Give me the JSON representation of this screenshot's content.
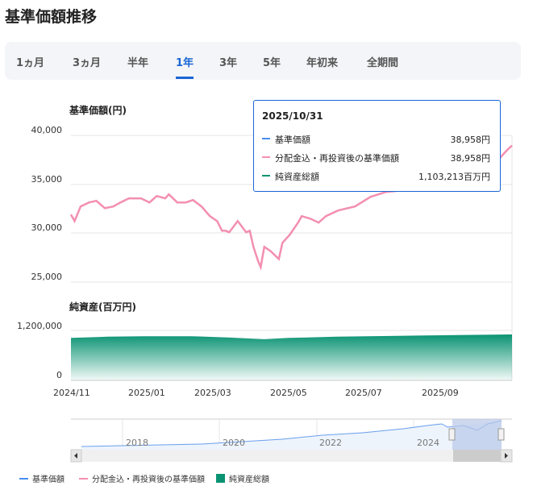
{
  "title": "基準価額推移",
  "tabs": [
    "1ヵ月",
    "3ヵ月",
    "半年",
    "1年",
    "3年",
    "5年",
    "年初来",
    "全期間"
  ],
  "active_tab": "1年",
  "colors": {
    "nav": "#4a8ef0",
    "reinvested": "#f48fb1",
    "assets": "#0a9373",
    "accent": "#1a66d6"
  },
  "chart_data": [
    {
      "type": "line",
      "title": "基準価額(円)",
      "ylim": [
        25000,
        40000
      ],
      "yticks": [
        "40,000",
        "35,000",
        "30,000",
        "25,000"
      ],
      "x_unit": "days since 2024/10/31",
      "series": [
        {
          "name": "基準価額",
          "points": [
            [
              0,
              31900
            ],
            [
              3,
              31240
            ],
            [
              8,
              32730
            ],
            [
              15,
              33140
            ],
            [
              21,
              33310
            ],
            [
              28,
              32560
            ],
            [
              35,
              32730
            ],
            [
              41,
              33140
            ],
            [
              48,
              33560
            ],
            [
              58,
              33560
            ],
            [
              65,
              33140
            ],
            [
              71,
              33800
            ],
            [
              78,
              33560
            ],
            [
              81,
              33970
            ],
            [
              88,
              33140
            ],
            [
              95,
              33140
            ],
            [
              101,
              33390
            ],
            [
              108,
              32730
            ],
            [
              115,
              31740
            ],
            [
              121,
              31240
            ],
            [
              125,
              30250
            ],
            [
              128,
              30250
            ],
            [
              131,
              30090
            ],
            [
              138,
              31240
            ],
            [
              145,
              30090
            ],
            [
              148,
              30250
            ],
            [
              151,
              28600
            ],
            [
              155,
              27110
            ],
            [
              157,
              26530
            ],
            [
              160,
              28600
            ],
            [
              165,
              28190
            ],
            [
              172,
              27360
            ],
            [
              175,
              29010
            ],
            [
              181,
              29840
            ],
            [
              188,
              31080
            ],
            [
              191,
              31740
            ],
            [
              198,
              31490
            ],
            [
              205,
              31080
            ],
            [
              211,
              31740
            ],
            [
              221,
              32320
            ],
            [
              235,
              32730
            ],
            [
              248,
              33720
            ],
            [
              261,
              34220
            ],
            [
              275,
              34380
            ],
            [
              288,
              35040
            ],
            [
              301,
              35620
            ],
            [
              315,
              36450
            ],
            [
              328,
              36450
            ],
            [
              341,
              36860
            ],
            [
              348,
              37270
            ],
            [
              355,
              37690
            ],
            [
              361,
              38510
            ],
            [
              365,
              38958
            ]
          ]
        }
      ]
    },
    {
      "type": "area",
      "title": "純資産(百万円)",
      "ylim": [
        0,
        1200000
      ],
      "yticks": [
        "1,200,000",
        "0"
      ],
      "series": [
        {
          "name": "純資産総額",
          "points": [
            [
              0,
              1020000
            ],
            [
              30,
              1050000
            ],
            [
              60,
              1060000
            ],
            [
              100,
              1060000
            ],
            [
              130,
              1030000
            ],
            [
              160,
              990000
            ],
            [
              180,
              1020000
            ],
            [
              220,
              1050000
            ],
            [
              270,
              1070000
            ],
            [
              320,
              1090000
            ],
            [
              365,
              1103213
            ]
          ]
        }
      ]
    }
  ],
  "xticks": [
    "2024/11",
    "2025/01",
    "2025/03",
    "2025/05",
    "2025/07",
    "2025/09"
  ],
  "navigator": {
    "years": [
      "2018",
      "2020",
      "2022",
      "2024"
    ]
  },
  "tooltip": {
    "date": "2025/10/31",
    "rows": [
      {
        "label": "基準価額",
        "value": "38,958円"
      },
      {
        "label": "分配金込・再投資後の基準価額",
        "value": "38,958円"
      },
      {
        "label": "純資産総額",
        "value": "1,103,213百万円"
      }
    ]
  },
  "legend": [
    "基準価額",
    "分配金込・再投資後の基準価額",
    "純資産総額"
  ]
}
